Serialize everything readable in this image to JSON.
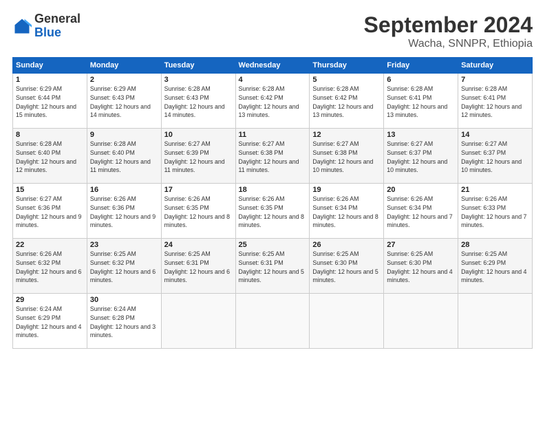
{
  "logo": {
    "line1": "General",
    "line2": "Blue"
  },
  "title": "September 2024",
  "location": "Wacha, SNNPR, Ethiopia",
  "days_header": [
    "Sunday",
    "Monday",
    "Tuesday",
    "Wednesday",
    "Thursday",
    "Friday",
    "Saturday"
  ],
  "weeks": [
    [
      {
        "day": "1",
        "info": "Sunrise: 6:29 AM\nSunset: 6:44 PM\nDaylight: 12 hours\nand 15 minutes."
      },
      {
        "day": "2",
        "info": "Sunrise: 6:29 AM\nSunset: 6:43 PM\nDaylight: 12 hours\nand 14 minutes."
      },
      {
        "day": "3",
        "info": "Sunrise: 6:28 AM\nSunset: 6:43 PM\nDaylight: 12 hours\nand 14 minutes."
      },
      {
        "day": "4",
        "info": "Sunrise: 6:28 AM\nSunset: 6:42 PM\nDaylight: 12 hours\nand 13 minutes."
      },
      {
        "day": "5",
        "info": "Sunrise: 6:28 AM\nSunset: 6:42 PM\nDaylight: 12 hours\nand 13 minutes."
      },
      {
        "day": "6",
        "info": "Sunrise: 6:28 AM\nSunset: 6:41 PM\nDaylight: 12 hours\nand 13 minutes."
      },
      {
        "day": "7",
        "info": "Sunrise: 6:28 AM\nSunset: 6:41 PM\nDaylight: 12 hours\nand 12 minutes."
      }
    ],
    [
      {
        "day": "8",
        "info": "Sunrise: 6:28 AM\nSunset: 6:40 PM\nDaylight: 12 hours\nand 12 minutes."
      },
      {
        "day": "9",
        "info": "Sunrise: 6:28 AM\nSunset: 6:40 PM\nDaylight: 12 hours\nand 11 minutes."
      },
      {
        "day": "10",
        "info": "Sunrise: 6:27 AM\nSunset: 6:39 PM\nDaylight: 12 hours\nand 11 minutes."
      },
      {
        "day": "11",
        "info": "Sunrise: 6:27 AM\nSunset: 6:38 PM\nDaylight: 12 hours\nand 11 minutes."
      },
      {
        "day": "12",
        "info": "Sunrise: 6:27 AM\nSunset: 6:38 PM\nDaylight: 12 hours\nand 10 minutes."
      },
      {
        "day": "13",
        "info": "Sunrise: 6:27 AM\nSunset: 6:37 PM\nDaylight: 12 hours\nand 10 minutes."
      },
      {
        "day": "14",
        "info": "Sunrise: 6:27 AM\nSunset: 6:37 PM\nDaylight: 12 hours\nand 10 minutes."
      }
    ],
    [
      {
        "day": "15",
        "info": "Sunrise: 6:27 AM\nSunset: 6:36 PM\nDaylight: 12 hours\nand 9 minutes."
      },
      {
        "day": "16",
        "info": "Sunrise: 6:26 AM\nSunset: 6:36 PM\nDaylight: 12 hours\nand 9 minutes."
      },
      {
        "day": "17",
        "info": "Sunrise: 6:26 AM\nSunset: 6:35 PM\nDaylight: 12 hours\nand 8 minutes."
      },
      {
        "day": "18",
        "info": "Sunrise: 6:26 AM\nSunset: 6:35 PM\nDaylight: 12 hours\nand 8 minutes."
      },
      {
        "day": "19",
        "info": "Sunrise: 6:26 AM\nSunset: 6:34 PM\nDaylight: 12 hours\nand 8 minutes."
      },
      {
        "day": "20",
        "info": "Sunrise: 6:26 AM\nSunset: 6:34 PM\nDaylight: 12 hours\nand 7 minutes."
      },
      {
        "day": "21",
        "info": "Sunrise: 6:26 AM\nSunset: 6:33 PM\nDaylight: 12 hours\nand 7 minutes."
      }
    ],
    [
      {
        "day": "22",
        "info": "Sunrise: 6:26 AM\nSunset: 6:32 PM\nDaylight: 12 hours\nand 6 minutes."
      },
      {
        "day": "23",
        "info": "Sunrise: 6:25 AM\nSunset: 6:32 PM\nDaylight: 12 hours\nand 6 minutes."
      },
      {
        "day": "24",
        "info": "Sunrise: 6:25 AM\nSunset: 6:31 PM\nDaylight: 12 hours\nand 6 minutes."
      },
      {
        "day": "25",
        "info": "Sunrise: 6:25 AM\nSunset: 6:31 PM\nDaylight: 12 hours\nand 5 minutes."
      },
      {
        "day": "26",
        "info": "Sunrise: 6:25 AM\nSunset: 6:30 PM\nDaylight: 12 hours\nand 5 minutes."
      },
      {
        "day": "27",
        "info": "Sunrise: 6:25 AM\nSunset: 6:30 PM\nDaylight: 12 hours\nand 4 minutes."
      },
      {
        "day": "28",
        "info": "Sunrise: 6:25 AM\nSunset: 6:29 PM\nDaylight: 12 hours\nand 4 minutes."
      }
    ],
    [
      {
        "day": "29",
        "info": "Sunrise: 6:24 AM\nSunset: 6:29 PM\nDaylight: 12 hours\nand 4 minutes."
      },
      {
        "day": "30",
        "info": "Sunrise: 6:24 AM\nSunset: 6:28 PM\nDaylight: 12 hours\nand 3 minutes."
      },
      {
        "day": "",
        "info": ""
      },
      {
        "day": "",
        "info": ""
      },
      {
        "day": "",
        "info": ""
      },
      {
        "day": "",
        "info": ""
      },
      {
        "day": "",
        "info": ""
      }
    ]
  ]
}
